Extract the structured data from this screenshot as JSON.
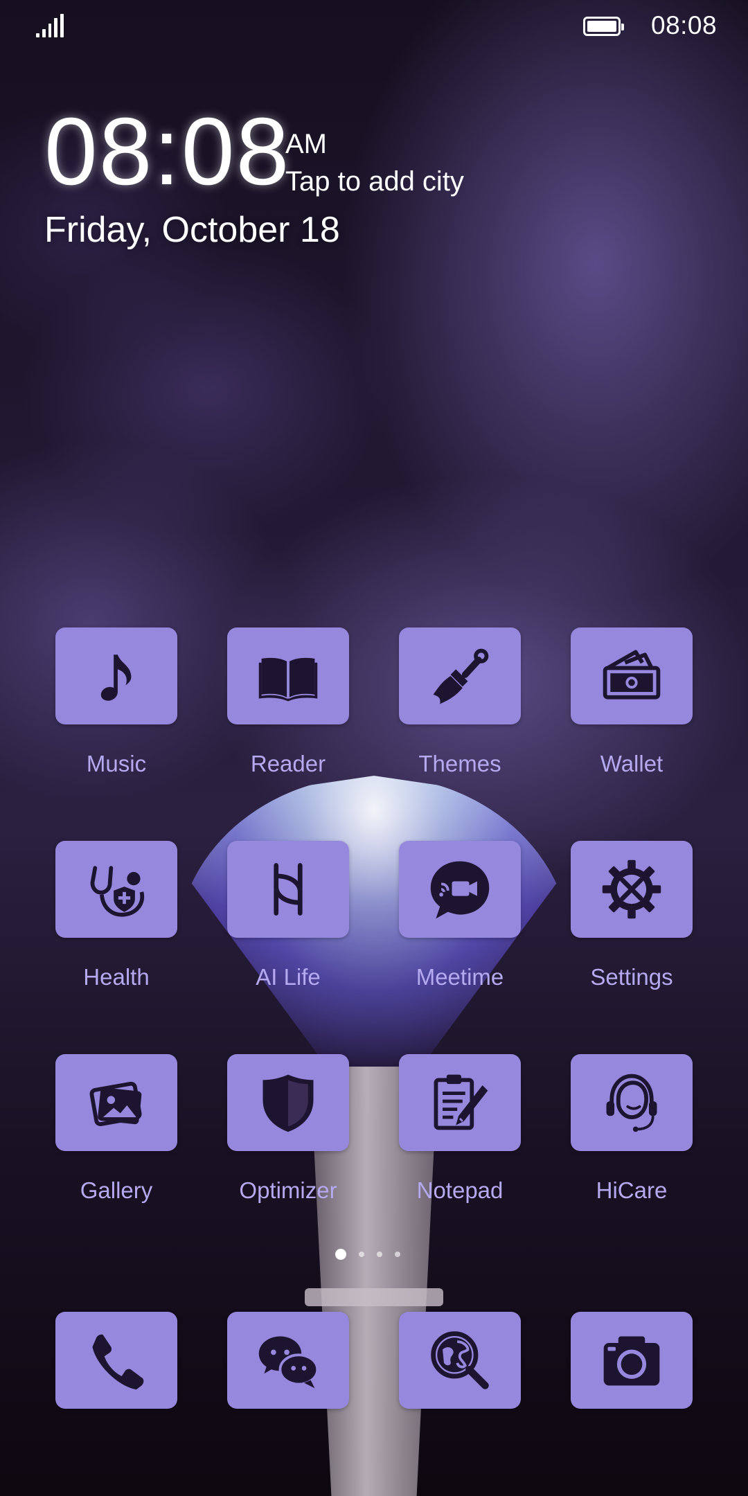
{
  "status_bar": {
    "time": "08:08",
    "signal_icon": "signal-icon",
    "battery_icon": "battery-icon"
  },
  "clock_widget": {
    "time": "08:08",
    "ampm": "AM",
    "city": "Tap to add city",
    "date": "Friday, October 18"
  },
  "apps": [
    {
      "label": "Music",
      "icon": "music-note-icon"
    },
    {
      "label": "Reader",
      "icon": "book-icon"
    },
    {
      "label": "Themes",
      "icon": "paintbrush-icon"
    },
    {
      "label": "Wallet",
      "icon": "wallet-icon"
    },
    {
      "label": "Health",
      "icon": "stethoscope-icon"
    },
    {
      "label": "AI Life",
      "icon": "ai-life-icon"
    },
    {
      "label": "Meetime",
      "icon": "video-chat-icon"
    },
    {
      "label": "Settings",
      "icon": "gear-icon"
    },
    {
      "label": "Gallery",
      "icon": "gallery-icon"
    },
    {
      "label": "Optimizer",
      "icon": "shield-icon"
    },
    {
      "label": "Notepad",
      "icon": "notepad-icon"
    },
    {
      "label": "HiCare",
      "icon": "headset-icon"
    }
  ],
  "page_indicator": {
    "pages": 4,
    "current": 1
  },
  "dock": [
    {
      "icon": "phone-icon"
    },
    {
      "icon": "messaging-icon"
    },
    {
      "icon": "browser-search-icon"
    },
    {
      "icon": "camera-icon"
    }
  ],
  "colors": {
    "tile": "#9688dc",
    "label": "#b5a9ef",
    "glyph": "#1d1430"
  }
}
